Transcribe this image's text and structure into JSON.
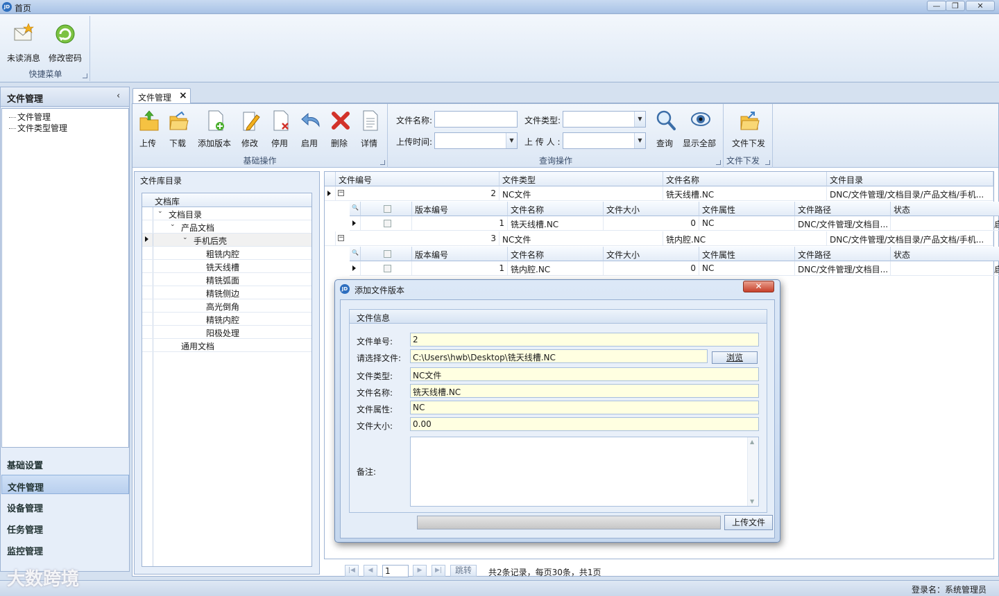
{
  "window": {
    "title": "首页",
    "app_icon": "JD",
    "controls": [
      "minimize-icon",
      "restore-icon",
      "close-icon"
    ]
  },
  "ribbon": {
    "quick_group_label": "快捷菜单",
    "buttons": [
      {
        "label": "未读消息",
        "icon": "mail-icon"
      },
      {
        "label": "修改密码",
        "icon": "refresh-key-icon"
      }
    ]
  },
  "nav": {
    "title": "文件管理",
    "tree": [
      "文件管理",
      "文件类型管理"
    ],
    "groups": [
      {
        "label": "基础设置",
        "active": false
      },
      {
        "label": "文件管理",
        "active": true
      },
      {
        "label": "设备管理",
        "active": false
      },
      {
        "label": "任务管理",
        "active": false
      },
      {
        "label": "监控管理",
        "active": false
      }
    ]
  },
  "tab": {
    "label": "文件管理",
    "close": "×"
  },
  "toolbar": {
    "basic": {
      "label": "基础操作",
      "buttons": [
        "上传",
        "下载",
        "添加版本",
        "修改",
        "停用",
        "启用",
        "删除",
        "详情"
      ]
    },
    "query": {
      "label": "查询操作",
      "file_name_label": "文件名称:",
      "file_type_label": "文件类型:",
      "upload_time_label": "上传时间:",
      "uploader_label": "上 传 人 :",
      "search_label": "查询",
      "show_all_label": "显示全部"
    },
    "dispatch": {
      "label": "文件下发",
      "button": "文件下发"
    }
  },
  "library": {
    "title": "文件库目录",
    "column": "文档库",
    "rows": [
      {
        "text": "文档目录",
        "level": 0,
        "expanded": true
      },
      {
        "text": "产品文档",
        "level": 1,
        "expanded": true
      },
      {
        "text": "手机后壳",
        "level": 2,
        "expanded": true,
        "selected": true
      },
      {
        "text": "粗铣内腔",
        "level": 3
      },
      {
        "text": "铣天线槽",
        "level": 3
      },
      {
        "text": "精铣弧面",
        "level": 3
      },
      {
        "text": "精铣侧边",
        "level": 3
      },
      {
        "text": "高光倒角",
        "level": 3
      },
      {
        "text": "精铣内腔",
        "level": 3
      },
      {
        "text": "阳极处理",
        "level": 3
      },
      {
        "text": "通用文档",
        "level": 1
      }
    ]
  },
  "grid": {
    "columns": [
      "文件编号",
      "文件类型",
      "文件名称",
      "文件目录"
    ],
    "sub_columns": [
      "版本编号",
      "文件名称",
      "文件大小",
      "文件属性",
      "文件路径",
      "状态"
    ],
    "records": [
      {
        "id": "2",
        "type": "NC文件",
        "name": "铣天线槽.NC",
        "dir": "DNC/文件管理/文档目录/产品文档/手机...",
        "versions": [
          {
            "ver": "1",
            "name": "铣天线槽.NC",
            "size": "0",
            "attr": "NC",
            "path": "DNC/文件管理/文档目...",
            "status": "启用"
          }
        ]
      },
      {
        "id": "3",
        "type": "NC文件",
        "name": "铣内腔.NC",
        "dir": "DNC/文件管理/文档目录/产品文档/手机...",
        "versions": [
          {
            "ver": "1",
            "name": "铣内腔.NC",
            "size": "0",
            "attr": "NC",
            "path": "DNC/文件管理/文档目...",
            "status": "启用"
          }
        ]
      }
    ]
  },
  "pager": {
    "page": "1",
    "jump": "跳转",
    "summary": "共2条记录，每页30条，共1页"
  },
  "status": {
    "login": "登录名：系统管理员"
  },
  "watermark": "大数跨境",
  "dialog": {
    "title": "添加文件版本",
    "close": "✕",
    "fieldset_title": "文件信息",
    "fields": {
      "file_no_label": "文件单号:",
      "file_no": "2",
      "select_label": "请选择文件:",
      "select_path": "C:\\Users\\hwb\\Desktop\\铣天线槽.NC",
      "browse": "浏览",
      "type_label": "文件类型:",
      "type": "NC文件",
      "name_label": "文件名称:",
      "name": "铣天线槽.NC",
      "attr_label": "文件属性:",
      "attr": "NC",
      "size_label": "文件大小:",
      "size": "0.00",
      "remark_label": "备注:"
    },
    "upload": "上传文件"
  },
  "colors": {
    "accent": "#2e6fbf",
    "ribbon": "#dde8f5",
    "input_yellow": "#ffffe1",
    "close_red": "#c7402a"
  }
}
